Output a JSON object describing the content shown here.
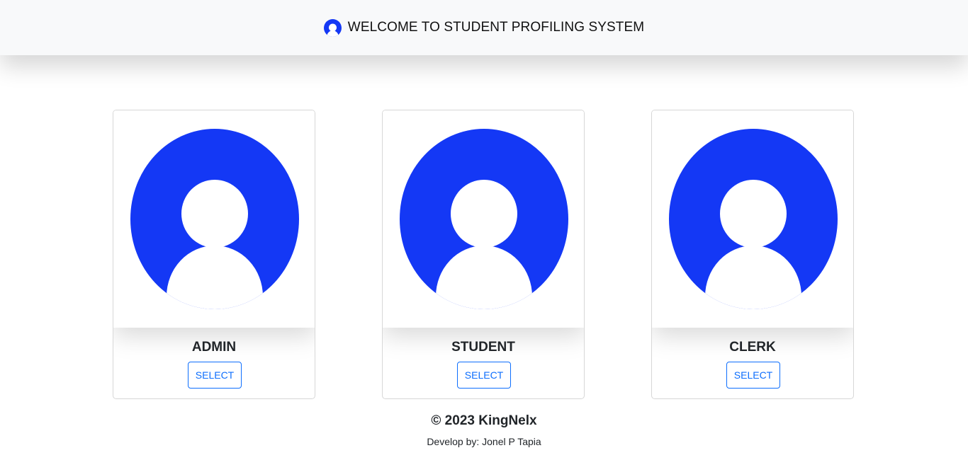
{
  "header": {
    "icon": "user-avatar-icon",
    "title": "WELCOME TO STUDENT PROFILING SYSTEM"
  },
  "cards": [
    {
      "icon": "user-avatar-icon",
      "title": "ADMIN",
      "button_label": "SELECT"
    },
    {
      "icon": "user-avatar-icon",
      "title": "STUDENT",
      "button_label": "SELECT"
    },
    {
      "icon": "user-avatar-icon",
      "title": "CLERK",
      "button_label": "SELECT"
    }
  ],
  "footer": {
    "copyright": "© 2023 KingNelx",
    "credit": "Develop by: Jonel P Tapia"
  },
  "colors": {
    "accent": "#1438f5",
    "button": "#0d6efd",
    "navbar_bg": "#f8f9fa"
  }
}
